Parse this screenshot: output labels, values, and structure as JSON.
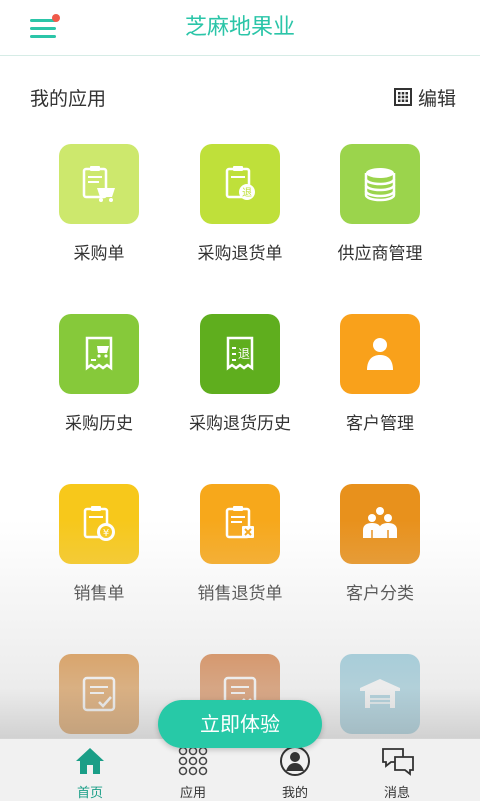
{
  "header": {
    "title": "芝麻地果业"
  },
  "section": {
    "title": "我的应用",
    "edit_label": "编辑"
  },
  "apps": [
    {
      "label": "采购单",
      "icon": "purchase-order-icon",
      "color": "#cde86d"
    },
    {
      "label": "采购退货单",
      "icon": "purchase-return-icon",
      "color": "#bfe03a"
    },
    {
      "label": "供应商管理",
      "icon": "supplier-database-icon",
      "color": "#9bd44c"
    },
    {
      "label": "采购历史",
      "icon": "purchase-history-icon",
      "color": "#86c93a"
    },
    {
      "label": "采购退货历史",
      "icon": "purchase-return-history-icon",
      "color": "#5fae1e"
    },
    {
      "label": "客户管理",
      "icon": "customer-person-icon",
      "color": "#f9a11b"
    },
    {
      "label": "销售单",
      "icon": "sales-order-icon",
      "color": "#f7c81b"
    },
    {
      "label": "销售退货单",
      "icon": "sales-return-icon",
      "color": "#f7a81b"
    },
    {
      "label": "客户分类",
      "icon": "customer-group-icon",
      "color": "#e8911c"
    },
    {
      "label": "",
      "icon": "checklist-icon",
      "color": "#d67a16"
    },
    {
      "label": "",
      "icon": "reject-list-icon",
      "color": "#d0641a"
    },
    {
      "label": "",
      "icon": "warehouse-icon",
      "color": "#7fc1d6"
    }
  ],
  "cta": {
    "label": "立即体验"
  },
  "tabs": [
    {
      "label": "首页",
      "icon": "home-icon"
    },
    {
      "label": "应用",
      "icon": "apps-grid-icon"
    },
    {
      "label": "我的",
      "icon": "profile-icon"
    },
    {
      "label": "消息",
      "icon": "chat-bubbles-icon"
    }
  ],
  "colors": {
    "accent": "#2bc5a8",
    "cta": "#27c9a7",
    "notification": "#f05a4a"
  }
}
